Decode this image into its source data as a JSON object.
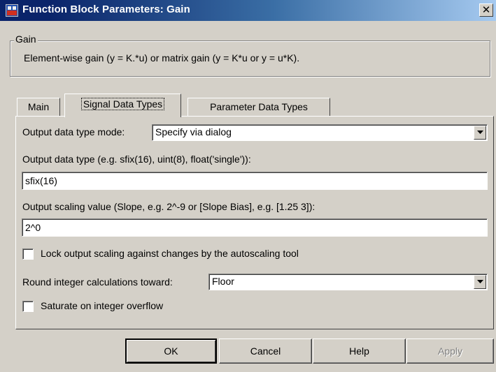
{
  "window": {
    "title": "Function Block Parameters: Gain",
    "close_label": "✕"
  },
  "group": {
    "legend": "Gain",
    "description": "Element-wise gain (y = K.*u) or matrix gain (y = K*u or y = u*K)."
  },
  "tabs": [
    {
      "label": "Main",
      "active": false
    },
    {
      "label": "Signal Data Types",
      "active": true
    },
    {
      "label": "Parameter Data Types",
      "active": false
    }
  ],
  "fields": {
    "output_mode_label": "Output data type mode:",
    "output_mode_value": "Specify via dialog",
    "output_type_label": "Output data type (e.g. sfix(16), uint(8), float('single')):",
    "output_type_value": "sfix(16)",
    "scaling_label": "Output scaling value (Slope, e.g. 2^-9 or [Slope Bias], e.g. [1.25 3]):",
    "scaling_value": "2^0",
    "lock_label": "Lock output scaling against changes by the autoscaling tool",
    "lock_checked": false,
    "round_label": "Round integer calculations toward:",
    "round_value": "Floor",
    "saturate_label": "Saturate on integer overflow",
    "saturate_checked": false
  },
  "buttons": {
    "ok": "OK",
    "cancel": "Cancel",
    "help": "Help",
    "apply": "Apply"
  },
  "icons": {
    "title_icon": "simulink-block-icon",
    "close_icon": "close-icon",
    "dropdown_icon": "chevron-down-icon"
  }
}
